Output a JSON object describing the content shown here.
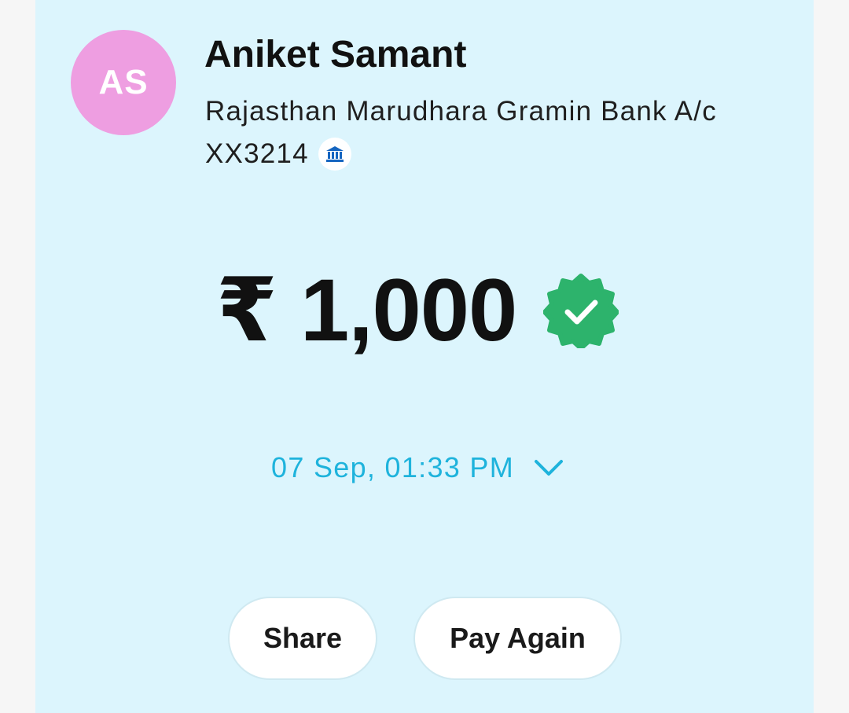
{
  "payee": {
    "initials": "AS",
    "name": "Aniket Samant",
    "bank_line1": "Rajasthan Marudhara Gramin Bank A/c",
    "bank_line2": "XX3214"
  },
  "transaction": {
    "amount": "₹ 1,000",
    "status_icon": "verified-check-icon",
    "datetime": "07 Sep, 01:33 PM"
  },
  "actions": {
    "share_label": "Share",
    "pay_again_label": "Pay Again"
  },
  "colors": {
    "card_background": "#dcf5fd",
    "avatar": "#ee9ee1",
    "accent": "#1eb3dc",
    "success": "#2db36c"
  }
}
